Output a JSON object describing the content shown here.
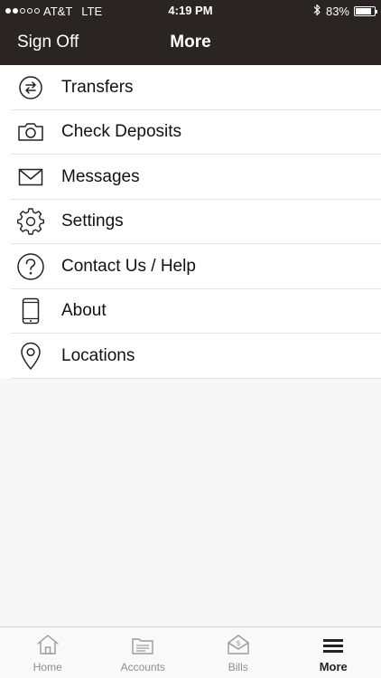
{
  "status_bar": {
    "carrier": "AT&T",
    "network": "LTE",
    "time": "4:19 PM",
    "battery_text": "83%",
    "battery_level": 0.83,
    "signal_bars_filled": 2,
    "signal_bars_total": 5
  },
  "nav_bar": {
    "left_button": "Sign Off",
    "title": "More"
  },
  "menu": {
    "items": [
      {
        "label": "Transfers",
        "icon": "transfer-arrows-icon"
      },
      {
        "label": "Check Deposits",
        "icon": "camera-icon"
      },
      {
        "label": "Messages",
        "icon": "envelope-icon"
      },
      {
        "label": "Settings",
        "icon": "gear-icon"
      },
      {
        "label": "Contact Us / Help",
        "icon": "question-circle-icon"
      },
      {
        "label": "About",
        "icon": "phone-device-icon"
      },
      {
        "label": "Locations",
        "icon": "map-pin-icon"
      }
    ]
  },
  "tab_bar": {
    "tabs": [
      {
        "label": "Home",
        "icon": "house-icon"
      },
      {
        "label": "Accounts",
        "icon": "folder-icon"
      },
      {
        "label": "Bills",
        "icon": "bill-envelope-icon"
      },
      {
        "label": "More",
        "icon": "hamburger-icon"
      }
    ],
    "active": "More"
  },
  "colors": {
    "header_bg": "#2a2522",
    "header_text": "#ffffff",
    "list_bg": "#ffffff",
    "page_bg": "#f7f7f7",
    "divider": "#e4e4e4",
    "tab_inactive": "#8e8e8e",
    "tab_active": "#222222"
  }
}
